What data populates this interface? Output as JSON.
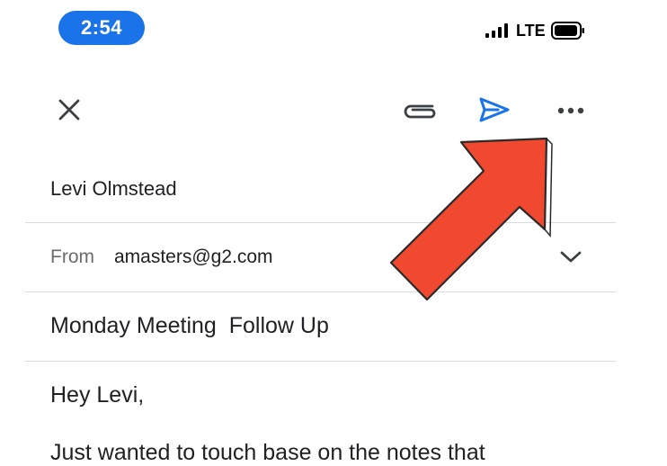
{
  "status_bar": {
    "time": "2:54",
    "network": "LTE",
    "icons": [
      "signal-icon",
      "battery-icon"
    ]
  },
  "toolbar": {
    "icons": [
      "close-icon",
      "attach-icon",
      "send-icon",
      "more-icon"
    ],
    "send_color": "#1a73e8"
  },
  "compose": {
    "to": "Levi Olmstead",
    "from_label": "From",
    "from_value": "amasters@g2.com",
    "subject": "Monday Meeting  Follow Up",
    "body_lines": [
      "Hey Levi,",
      "Just wanted to touch base on the notes that"
    ]
  },
  "annotation": {
    "arrow_color": "#f0492f",
    "icon": "red-arrow-pointer"
  }
}
